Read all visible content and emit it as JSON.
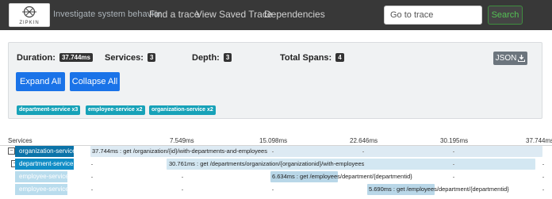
{
  "navbar": {
    "logo_text": "ZIPKIN",
    "tagline": "Investigate system behavior",
    "links": [
      "Find a trace",
      "View Saved Trace",
      "Dependencies"
    ],
    "search_placeholder": "Go to trace",
    "search_button": "Search"
  },
  "summary": {
    "duration_label": "Duration:",
    "duration_value": "37.744ms",
    "services_label": "Services:",
    "services_value": "3",
    "depth_label": "Depth:",
    "depth_value": "3",
    "total_spans_label": "Total Spans:",
    "total_spans_value": "4",
    "json_button": "JSON",
    "expand_all": "Expand All",
    "collapse_all": "Collapse All",
    "service_badges": [
      "department-service x3",
      "employee-service x2",
      "organization-service x2"
    ]
  },
  "timeline": {
    "services_header": "Services",
    "ticks": [
      "7.549ms",
      "15.098ms",
      "22.646ms",
      "30.195ms",
      "37.744ms"
    ],
    "spans": [
      {
        "service": "organization-service",
        "duration": "37.744ms",
        "label": "37.744ms : get /organization/{id}/with-departments-and-employees",
        "start_ms": 0,
        "duration_ms": 37.744,
        "depth": 0,
        "collapsible": true
      },
      {
        "service": "department-service",
        "duration": "30.761ms",
        "label": "30.761ms : get /departments/organization/{organizationid}/with-employees",
        "start_ms": 6.1,
        "duration_ms": 30.761,
        "depth": 1,
        "collapsible": true
      },
      {
        "service": "employee-service",
        "duration": "6.634ms",
        "label": "6.634ms : get /employees/department/{departmentid}",
        "start_ms": 14.9,
        "duration_ms": 6.634,
        "depth": 2,
        "collapsible": false
      },
      {
        "service": "employee-service",
        "duration": "5.690ms",
        "label": "5.690ms : get /employees/department/{departmentid}",
        "start_ms": 23.1,
        "duration_ms": 5.69,
        "depth": 2,
        "collapsible": false
      }
    ],
    "colors": {
      "organization-service": "#0b73a8",
      "department-service": "#108dc6",
      "employee-service": "#b9dced",
      "span_root": "#ddeaf3",
      "span_dept": "#d3e7f2",
      "span_emp": "#b9d7e8"
    }
  }
}
